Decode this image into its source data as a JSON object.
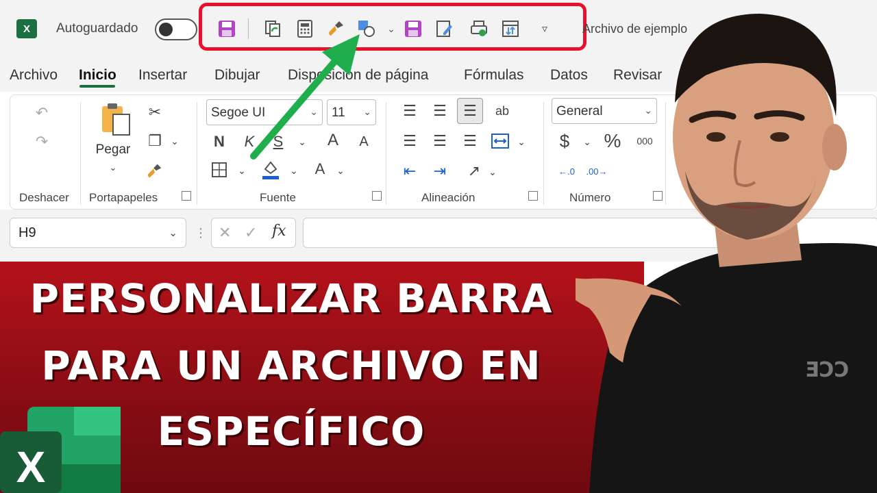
{
  "titlebar": {
    "app_logo": "X",
    "autosave_label": "Autoguardado",
    "doc_title": "Archivo de ejemplo",
    "qat_icons": [
      "save-icon",
      "refresh-copy-icon",
      "calculator-icon",
      "format-painter-icon",
      "shapes-icon",
      "chevron-down-icon",
      "save-as-icon",
      "edit-doc-icon",
      "print-preview-icon",
      "sort-icon",
      "customize-qat-icon"
    ]
  },
  "tabs": [
    "Archivo",
    "Inicio",
    "Insertar",
    "Dibujar",
    "Disposición de página",
    "Fórmulas",
    "Datos",
    "Revisar"
  ],
  "ribbon": {
    "groups": {
      "undo": "Deshacer",
      "clipboard": "Portapapeles",
      "font": "Fuente",
      "alignment": "Alineación",
      "number": "Número"
    },
    "paste_label": "Pegar",
    "font_name": "Segoe UI",
    "font_size": "11",
    "number_format": "General",
    "bold": "N",
    "italic": "K",
    "underline": "S",
    "grow_font": "A",
    "shrink_font": "A",
    "font_color": "A",
    "currency": "$",
    "percent": "%",
    "thousands": "000",
    "wrap": "ab"
  },
  "formula_bar": {
    "name_box": "H9",
    "fx": "fx"
  },
  "banner": {
    "line1": "PERSONALIZAR BARRA",
    "line2": "PARA UN ARCHIVO EN",
    "line3": "ESPECÍFICO"
  },
  "colors": {
    "excel_green": "#1d6f42",
    "highlight_red": "#e8102b",
    "arrow_green": "#1fae4b",
    "banner_red": "#b5121b"
  }
}
